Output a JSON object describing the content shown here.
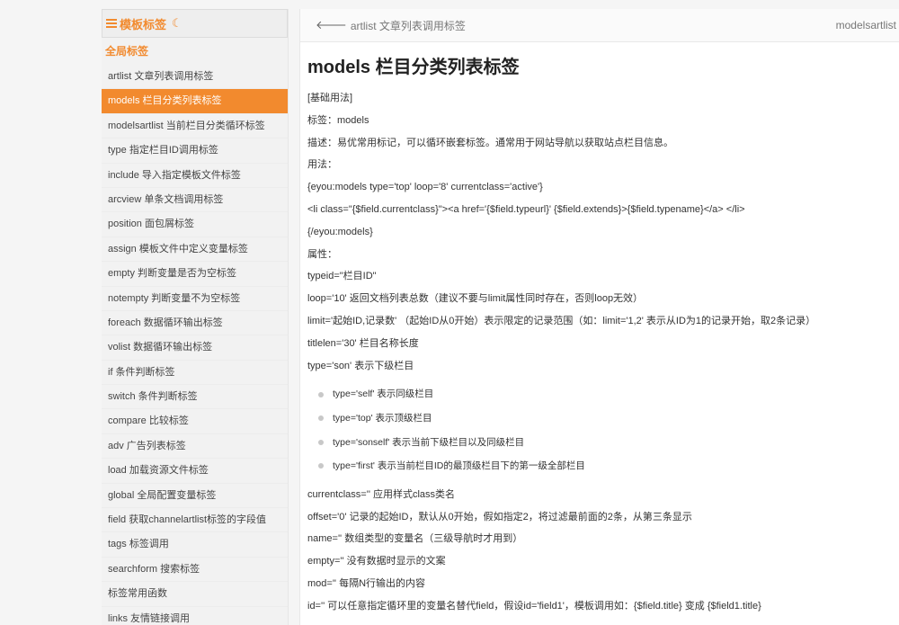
{
  "sidebar": {
    "header_title": "模板标签",
    "section_title": "全局标签",
    "items": [
      {
        "label": "artlist 文章列表调用标签"
      },
      {
        "label": "models 栏目分类列表标签",
        "active": true
      },
      {
        "label": "modelsartlist 当前栏目分类循环标签"
      },
      {
        "label": "type 指定栏目ID调用标签"
      },
      {
        "label": "include 导入指定模板文件标签"
      },
      {
        "label": "arcview 单条文档调用标签"
      },
      {
        "label": "position 面包屑标签"
      },
      {
        "label": "assign 模板文件中定义变量标签"
      },
      {
        "label": "empty 判断变量是否为空标签"
      },
      {
        "label": "notempty 判断变量不为空标签"
      },
      {
        "label": "foreach 数据循环输出标签"
      },
      {
        "label": "volist 数据循环输出标签"
      },
      {
        "label": "if 条件判断标签"
      },
      {
        "label": "switch 条件判断标签"
      },
      {
        "label": "compare 比较标签"
      },
      {
        "label": "adv 广告列表标签"
      },
      {
        "label": "load 加载资源文件标签"
      },
      {
        "label": "global 全局配置变量标签"
      },
      {
        "label": "field 获取channelartlist标签的字段值"
      },
      {
        "label": "tags 标签调用"
      },
      {
        "label": "searchform 搜索标签"
      },
      {
        "label": "标签常用函数"
      },
      {
        "label": "links 友情链接调用"
      }
    ]
  },
  "topbar": {
    "prev_label": "artlist 文章列表调用标签",
    "next_label": "modelsartlist"
  },
  "main": {
    "title": "models 栏目分类列表标签",
    "lines_top": [
      "[基础用法]",
      "标签：models",
      "描述：易优常用标记，可以循环嵌套标签。通常用于网站导航以获取站点栏目信息。",
      "用法：",
      "{eyou:models type='top' loop='8' currentclass='active'}",
      "<li class=\"{$field.currentclass}\"><a href='{$field.typeurl}'  {$field.extends}>{$field.typename}</a> </li>",
      "{/eyou:models}",
      "属性：",
      "typeid=\"栏目ID\"",
      "loop='10' 返回文档列表总数（建议不要与limit属性同时存在，否则loop无效）",
      "limit='起始ID,记录数' （起始ID从0开始）表示限定的记录范围（如：limit='1,2' 表示从ID为1的记录开始，取2条记录）",
      "titlelen='30' 栏目名称长度",
      "type='son' 表示下级栏目"
    ],
    "bullets": [
      "type='self' 表示同级栏目",
      "type='top' 表示顶级栏目",
      "type='sonself' 表示当前下级栏目以及同级栏目",
      "type='first' 表示当前栏目ID的最顶级栏目下的第一级全部栏目"
    ],
    "lines_bottom": [
      "currentclass='' 应用样式class类名",
      "offset='0' 记录的起始ID，默认从0开始，假如指定2，将过滤最前面的2条，从第三条显示",
      "name='' 数组类型的变量名（三级导航时才用到）",
      "empty='' 没有数据时显示的文案",
      "mod='' 每隔N行输出的内容",
      "id='' 可以任意指定循环里的变量名替代field，假设id='field1'，模板调用如：{$field.title} 变成 {$field1.title}"
    ]
  },
  "colors": {
    "accent": "#f28a2e"
  }
}
